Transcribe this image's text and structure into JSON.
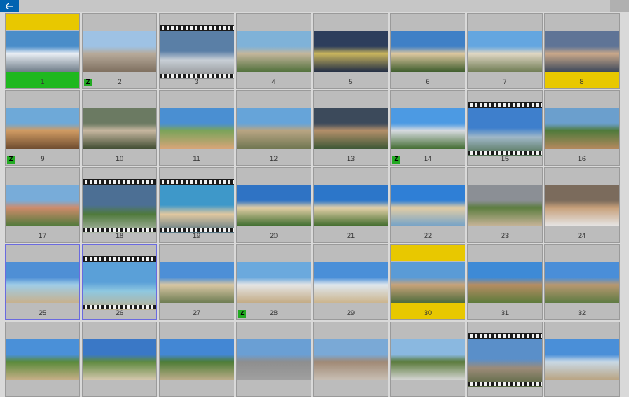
{
  "app": {
    "back_icon": "arrow-left-icon"
  },
  "tiles": [
    {
      "n": "1",
      "style": "band-green-bottom",
      "top_yellow": true,
      "colors": [
        "#4a8dc9",
        "#e9eef4",
        "#6c7a86"
      ]
    },
    {
      "n": "2",
      "z": "Z",
      "colors": [
        "#9ec2e4",
        "#b7aa9a",
        "#7d6e5e"
      ]
    },
    {
      "n": "3",
      "film": true,
      "colors": [
        "#5a7fa6",
        "#c8cfd6",
        "#777"
      ]
    },
    {
      "n": "4",
      "colors": [
        "#7fb2d8",
        "#c4b69c",
        "#4f6f3a"
      ]
    },
    {
      "n": "5",
      "colors": [
        "#2d3e5c",
        "#c9b55d",
        "#1d2a45"
      ]
    },
    {
      "n": "6",
      "colors": [
        "#3f80c6",
        "#dcc7a0",
        "#3a5a2a"
      ]
    },
    {
      "n": "7",
      "colors": [
        "#64a6e0",
        "#e0d7c4",
        "#6d7a52"
      ]
    },
    {
      "n": "8",
      "yellow_bottom": true,
      "colors": [
        "#5f7496",
        "#c9a88a",
        "#39465a"
      ]
    },
    {
      "n": "9",
      "z": "Z",
      "colors": [
        "#6ea9d8",
        "#d09b63",
        "#6c4a2e"
      ]
    },
    {
      "n": "10",
      "colors": [
        "#6b7a62",
        "#c7b7a0",
        "#3d4a30"
      ]
    },
    {
      "n": "11",
      "colors": [
        "#4a8fd2",
        "#7aa35a",
        "#dba57a"
      ]
    },
    {
      "n": "12",
      "colors": [
        "#66a4d9",
        "#b8a583",
        "#6e7550"
      ]
    },
    {
      "n": "13",
      "colors": [
        "#3c4a5b",
        "#b38f6a",
        "#3a5634"
      ]
    },
    {
      "n": "14",
      "z": "Z",
      "colors": [
        "#4c9ae3",
        "#d7dbe0",
        "#3f6a2e"
      ]
    },
    {
      "n": "15",
      "film": true,
      "colors": [
        "#3e7fcc",
        "#9fb7c8",
        "#36592c"
      ]
    },
    {
      "n": "16",
      "colors": [
        "#6b9fcd",
        "#4f7a3b",
        "#b7895f"
      ]
    },
    {
      "n": "17",
      "colors": [
        "#78acd9",
        "#cf8b6b",
        "#4f7a3b"
      ]
    },
    {
      "n": "18",
      "film": true,
      "colors": [
        "#4c6f94",
        "#4f7a3b",
        "#c9c9c9"
      ]
    },
    {
      "n": "19",
      "film": true,
      "colors": [
        "#3e98c9",
        "#e1c8a0",
        "#2d5c7a"
      ]
    },
    {
      "n": "20",
      "colors": [
        "#2f73c4",
        "#e3cfa6",
        "#3b6b2d"
      ]
    },
    {
      "n": "21",
      "colors": [
        "#2c76c9",
        "#e5d2aa",
        "#3e6a2b"
      ]
    },
    {
      "n": "22",
      "colors": [
        "#2f7fd6",
        "#e3cda5",
        "#73a2c8"
      ]
    },
    {
      "n": "23",
      "colors": [
        "#8b8f95",
        "#5c7d3f",
        "#c9b59a"
      ]
    },
    {
      "n": "24",
      "colors": [
        "#7b6b5c",
        "#c7a07a",
        "#e6e6e6"
      ]
    },
    {
      "n": "25",
      "selected": true,
      "colors": [
        "#4f8fd5",
        "#9fcde7",
        "#c9b08a"
      ]
    },
    {
      "n": "26",
      "selected": true,
      "film": true,
      "colors": [
        "#5aa0d8",
        "#8fc8e0",
        "#c7a77a"
      ]
    },
    {
      "n": "27",
      "colors": [
        "#4d8fd6",
        "#d9c7a4",
        "#6a7a50"
      ]
    },
    {
      "n": "28",
      "z": "Z",
      "colors": [
        "#6ba9dd",
        "#e5e5e5",
        "#c2a982"
      ]
    },
    {
      "n": "29",
      "colors": [
        "#4a8fd8",
        "#dfe7ee",
        "#cbb38a"
      ]
    },
    {
      "n": "30",
      "yellow_top": true,
      "yellow_bottom": true,
      "colors": [
        "#5a9bd6",
        "#c9a37a",
        "#4a6a3a"
      ]
    },
    {
      "n": "31",
      "colors": [
        "#3e8ad6",
        "#b68d63",
        "#5a7a3a"
      ]
    },
    {
      "n": "32",
      "colors": [
        "#4a8ed8",
        "#b89871",
        "#5b7a41"
      ]
    },
    {
      "n": "",
      "colors": [
        "#4a90d8",
        "#5a8a3a",
        "#c9b08a"
      ]
    },
    {
      "n": "",
      "colors": [
        "#3a78c6",
        "#5f8a3f",
        "#d8c9b0"
      ]
    },
    {
      "n": "",
      "colors": [
        "#4387d4",
        "#4d7c35",
        "#bfae8c"
      ]
    },
    {
      "n": "",
      "colors": [
        "#6a9fd4",
        "#8e8e8e",
        "#a0a0a0"
      ]
    },
    {
      "n": "",
      "colors": [
        "#7aa9d6",
        "#a08975",
        "#c9c0b5"
      ]
    },
    {
      "n": "",
      "colors": [
        "#8ab8e0",
        "#5a7a3a",
        "#d8d8d8"
      ]
    },
    {
      "n": "",
      "film": true,
      "colors": [
        "#5a8fc9",
        "#9c8b78",
        "#3e5a2e"
      ]
    },
    {
      "n": "",
      "colors": [
        "#4a8fd8",
        "#c9d9e6",
        "#b9a27f"
      ]
    }
  ]
}
